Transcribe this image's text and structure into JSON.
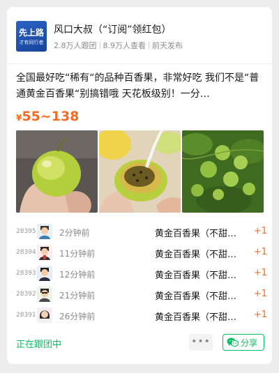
{
  "author": {
    "avatar_line1": "先上路",
    "avatar_line2": "才有同行者",
    "name": "风口大叔（“订阅”领红包）",
    "followers": "2.8万人跟团",
    "views": "8.9万人查看",
    "posted": "前天发布"
  },
  "post": {
    "description": "全国最好吃“稀有“的品种百香果，非常好吃 我们不是“普通黄金百香果“别搞错哦 天花板级别！一分…",
    "price_symbol": "¥",
    "price_range": "55~138"
  },
  "photos": [
    "passion-fruit-in-hand",
    "passion-fruit-pulp-spoon",
    "passion-fruit-vine"
  ],
  "orders": [
    {
      "number": "28395",
      "time": "2分钟前",
      "product": "黄金百香果（不甜…",
      "qty": "+1",
      "avatar": "user-avatar-1"
    },
    {
      "number": "28394",
      "time": "11分钟前",
      "product": "黄金百香果（不甜…",
      "qty": "+1",
      "avatar": "user-avatar-2"
    },
    {
      "number": "28393",
      "time": "12分钟前",
      "product": "黄金百香果（不甜…",
      "qty": "+1",
      "avatar": "user-avatar-3"
    },
    {
      "number": "28392",
      "time": "21分钟前",
      "product": "黄金百香果（不甜…",
      "qty": "+1",
      "avatar": "user-avatar-4"
    },
    {
      "number": "28391",
      "time": "26分钟前",
      "product": "黄金百香果（不甜…",
      "qty": "+1",
      "avatar": "user-avatar-5"
    }
  ],
  "footer": {
    "status": "正在跟团中",
    "more_label": "•••",
    "share_label": "分享"
  },
  "colors": {
    "accent_green": "#07c160",
    "price_orange": "#fa6a1e",
    "avatar_blue": "#1f56b8"
  }
}
